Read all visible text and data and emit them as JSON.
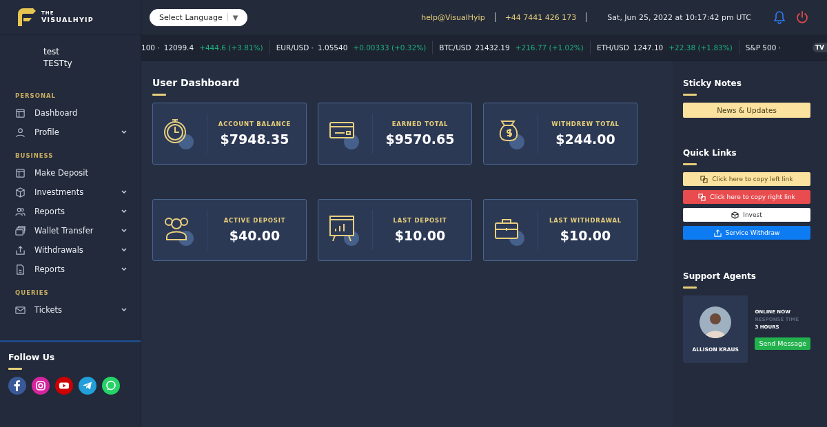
{
  "brand": {
    "line1": "THE",
    "line2": "VISUALHYIP"
  },
  "language_select": {
    "value": "Select Language",
    "caret": "▼"
  },
  "header": {
    "email": "help@VisualHyip",
    "phone": "+44 7441 426 173",
    "datetime": "Sat, Jun 25, 2022 at 10:17:42 pm UTC"
  },
  "user": {
    "first": "test",
    "last": "TESTty"
  },
  "ticker": [
    {
      "symbol": "100 ·",
      "price": "12099.4",
      "change": "+444.6 (+3.81%)"
    },
    {
      "symbol": "EUR/USD ·",
      "price": "1.05540",
      "change": "+0.00333 (+0.32%)"
    },
    {
      "symbol": "BTC/USD",
      "price": "21432.19",
      "change": "+216.77 (+1.02%)"
    },
    {
      "symbol": "ETH/USD",
      "price": "1247.10",
      "change": "+22.38 (+1.83%)"
    },
    {
      "symbol": "S&P 500 ·"
    }
  ],
  "ticker_badge": "TV",
  "sidebar": [
    {
      "heading": "PERSONAL",
      "items": [
        {
          "label": "Dashboard",
          "submenu": false
        },
        {
          "label": "Profile",
          "submenu": true
        }
      ]
    },
    {
      "heading": "BUSINESS",
      "items": [
        {
          "label": "Make Deposit",
          "submenu": false
        },
        {
          "label": "Investments",
          "submenu": true
        },
        {
          "label": "Reports",
          "submenu": true
        },
        {
          "label": "Wallet Transfer",
          "submenu": true
        },
        {
          "label": "Withdrawals",
          "submenu": true
        },
        {
          "label": "Reports",
          "submenu": true
        }
      ]
    },
    {
      "heading": "QUERIES",
      "items": [
        {
          "label": "Tickets",
          "submenu": true
        }
      ]
    }
  ],
  "follow_us": {
    "title": "Follow Us"
  },
  "page_title": "User Dashboard",
  "stats": [
    {
      "label": "ACCOUNT BALANCE",
      "value": "$7948.35"
    },
    {
      "label": "EARNED TOTAL",
      "value": "$9570.65"
    },
    {
      "label": "WITHDREW TOTAL",
      "value": "$244.00"
    },
    {
      "label": "ACTIVE DEPOSIT",
      "value": "$40.00"
    },
    {
      "label": "LAST DEPOSIT",
      "value": "$10.00"
    },
    {
      "label": "LAST WITHDRAWAL",
      "value": "$10.00"
    }
  ],
  "sticky_notes": {
    "title": "Sticky Notes",
    "button": "News & Updates"
  },
  "quick_links": {
    "title": "Quick Links",
    "items": [
      {
        "label": "Click here to copy left link",
        "color": "#fbe29f"
      },
      {
        "label": "Click here to copy right link",
        "color": "#e84c4f"
      },
      {
        "label": "Invest",
        "color": "#ffffff"
      },
      {
        "label": "Service Withdraw",
        "color": "#0d7bf2"
      }
    ]
  },
  "support": {
    "title": "Support Agents",
    "name": "ALLISON KRAUS",
    "status": "ONLINE NOW",
    "response_label": "RESPONSE TIME",
    "response_value": "3 HOURS",
    "button": "Send Message"
  }
}
